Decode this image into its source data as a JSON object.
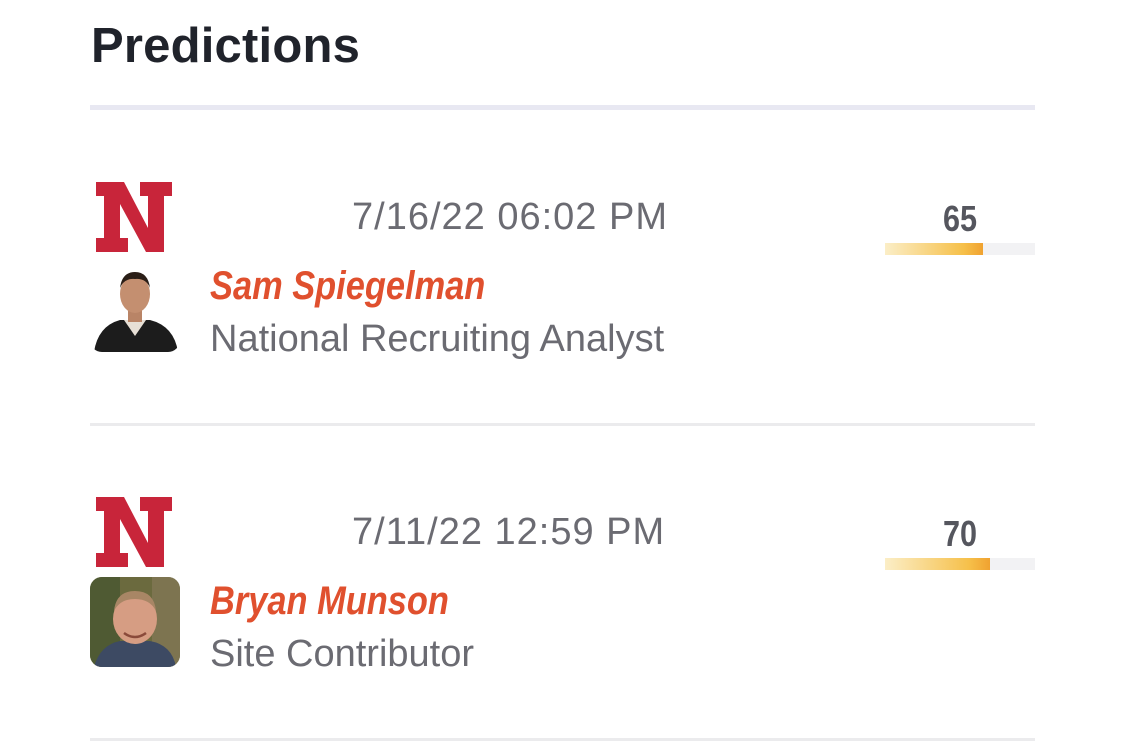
{
  "section": {
    "title": "Predictions"
  },
  "predictions": [
    {
      "team_icon": "nebraska-n-logo",
      "date": "7/16/22 06:02 PM",
      "analyst_name": "Sam Spiegelman",
      "analyst_role": "National Recruiting Analyst",
      "confidence": "65",
      "confidence_fraction": 0.65
    },
    {
      "team_icon": "nebraska-n-logo",
      "date": "7/11/22 12:59 PM",
      "analyst_name": "Bryan Munson",
      "analyst_role": "Site Contributor",
      "confidence": "70",
      "confidence_fraction": 0.7
    }
  ],
  "colors": {
    "team_red": "#c8253a",
    "name_accent": "#e0502e",
    "bar_start": "#fbeec7",
    "bar_end": "#f0a230"
  }
}
